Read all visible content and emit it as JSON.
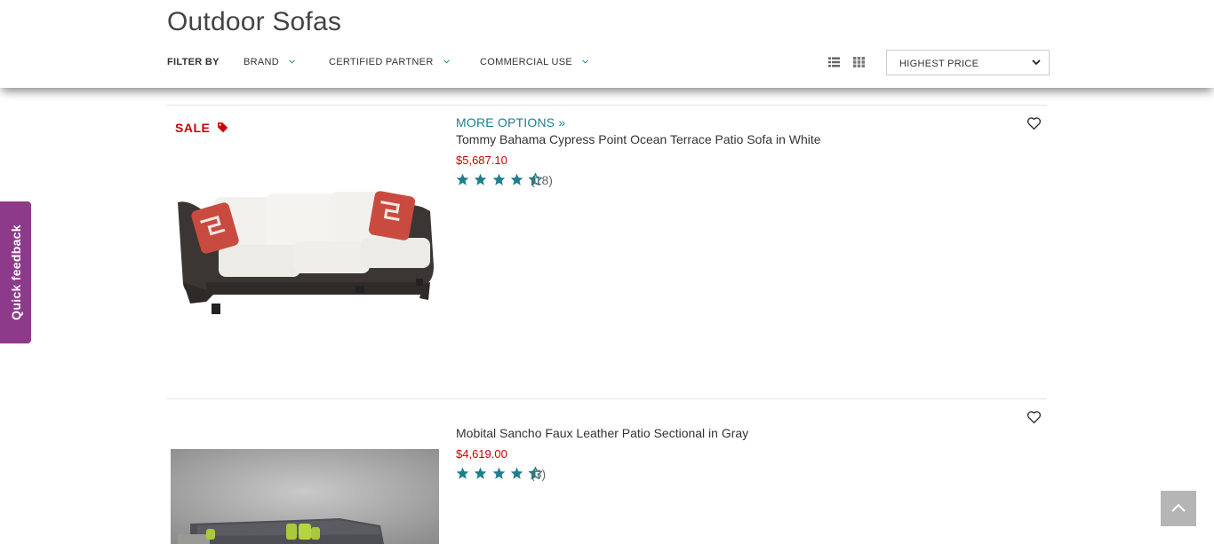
{
  "header": {
    "title": "Outdoor Sofas",
    "filter_by_label": "FILTER BY",
    "filters": [
      {
        "label": "BRAND"
      },
      {
        "label": "CERTIFIED PARTNER"
      },
      {
        "label": "COMMERCIAL USE"
      }
    ],
    "view_icons": [
      "list-view-icon",
      "grid-view-icon"
    ],
    "sort": {
      "selected": "HIGHEST PRICE"
    }
  },
  "products": [
    {
      "sale_label": "SALE",
      "more_options": "MORE OPTIONS »",
      "name": "Tommy Bahama Cypress Point Ocean Terrace Patio Sofa in White",
      "price": "$5,687.10",
      "rating": 4.5,
      "rating_count": "(18)"
    },
    {
      "name": "Mobital Sancho Faux Leather Patio Sectional in Gray",
      "price": "$4,619.00",
      "rating": 4.5,
      "rating_count": "(3)"
    }
  ],
  "quick_feedback": "Quick feedback",
  "colors": {
    "accent_teal": "#1b7f8e",
    "price_red": "#cc0000",
    "feedback_purple": "#8e3a8b"
  }
}
